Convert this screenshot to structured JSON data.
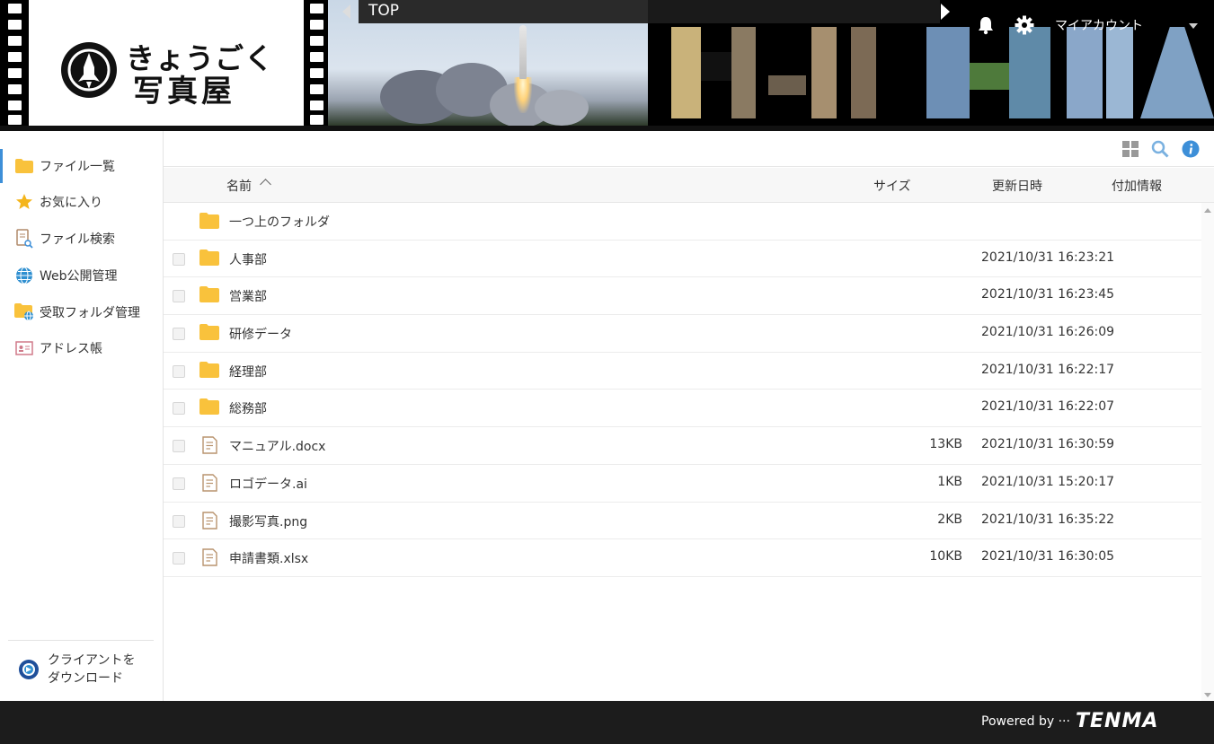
{
  "header": {
    "logo": {
      "line1": "きょうごく",
      "line2": "写真屋"
    },
    "breadcrumb": "TOP",
    "account_label": "マイアカウント",
    "icons": [
      "bell-icon",
      "gear-icon",
      "chevron-down-icon"
    ]
  },
  "sidebar": {
    "items": [
      {
        "label": "ファイル一覧",
        "icon": "folder-icon",
        "active": true
      },
      {
        "label": "お気に入り",
        "icon": "star-icon"
      },
      {
        "label": "ファイル検索",
        "icon": "file-search-icon"
      },
      {
        "label": "Web公開管理",
        "icon": "globe-icon"
      },
      {
        "label": "受取フォルダ管理",
        "icon": "folder-globe-icon"
      },
      {
        "label": "アドレス帳",
        "icon": "address-card-icon"
      }
    ],
    "client_download": {
      "line1": "クライアントを",
      "line2": "ダウンロード"
    }
  },
  "toolbar": {
    "icons": [
      "grid-view-icon",
      "search-icon",
      "info-icon"
    ]
  },
  "table": {
    "columns": {
      "name": "名前",
      "size": "サイズ",
      "modified": "更新日時",
      "extra": "付加情報"
    },
    "parent_folder": "一つ上のフォルダ",
    "rows": [
      {
        "type": "folder",
        "name": "人事部",
        "size": "",
        "date": "2021/10/31 16:23:21"
      },
      {
        "type": "folder",
        "name": "営業部",
        "size": "",
        "date": "2021/10/31 16:23:45"
      },
      {
        "type": "folder",
        "name": "研修データ",
        "size": "",
        "date": "2021/10/31 16:26:09"
      },
      {
        "type": "folder",
        "name": "経理部",
        "size": "",
        "date": "2021/10/31 16:22:17"
      },
      {
        "type": "folder",
        "name": "総務部",
        "size": "",
        "date": "2021/10/31 16:22:07"
      },
      {
        "type": "file",
        "name": "マニュアル.docx",
        "size": "13KB",
        "date": "2021/10/31 16:30:59"
      },
      {
        "type": "file",
        "name": "ロゴデータ.ai",
        "size": "1KB",
        "date": "2021/10/31 15:20:17"
      },
      {
        "type": "file",
        "name": "撮影写真.png",
        "size": "2KB",
        "date": "2021/10/31 16:35:22"
      },
      {
        "type": "file",
        "name": "申請書類.xlsx",
        "size": "10KB",
        "date": "2021/10/31 16:30:05"
      }
    ]
  },
  "footer": {
    "powered": "Powered by ···",
    "brand": "TENMA"
  },
  "colors": {
    "accent": "#3d8fd8",
    "folder": "#f9c23c",
    "header_bg": "#000000",
    "footer_bg": "#1c1c1c"
  }
}
